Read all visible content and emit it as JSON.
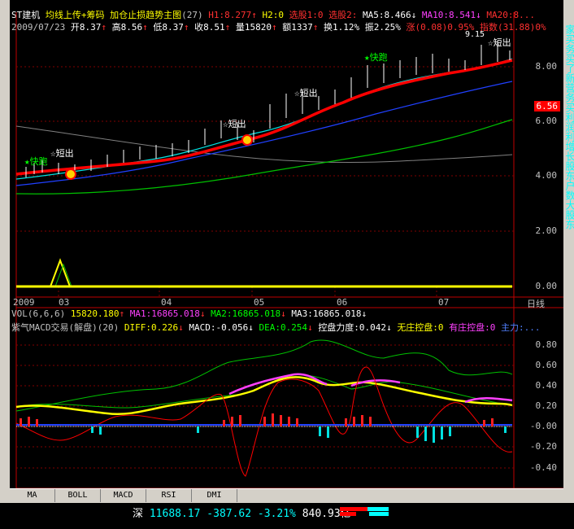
{
  "header": {
    "stock": "ST建机",
    "indicator_name": "均线上传+筹码 加仓止损趋势主图",
    "indicator_param": "(27)",
    "h1_label": "H1:",
    "h1_value": "8.277",
    "h1_arrow": "↑",
    "h2_label": "H2:0",
    "xuangu": "选股1:0",
    "xuangu2": "选股2:",
    "ma5": "MA5:8.466",
    "ma5_arrow": "↓",
    "ma10": "MA10:8.541",
    "ma10_arrow": "↓",
    "ma20": "MA20:8...",
    "date": "2009/07/23",
    "open": "开8.37",
    "open_arrow": "↑",
    "high": "高8.56",
    "high_arrow": "↑",
    "low": "低8.37",
    "low_arrow": "↑",
    "close": "收8.51",
    "close_arrow": "↑",
    "volume": "量15820",
    "volume_arrow": "↑",
    "amount": "额1337",
    "amount_arrow": "↑",
    "turnover": "换1.12%",
    "amplitude": "振2.25%",
    "change": "涨(0.08)0.95%",
    "index": "指数(31.88)0%"
  },
  "price_axis": {
    "labels": [
      "8.00",
      "6.00",
      "4.00",
      "2.00",
      "0.00"
    ],
    "current_price": "6.56",
    "top_value": "9.15"
  },
  "x_axis": {
    "labels": [
      "2009",
      "03",
      "04",
      "05",
      "06",
      "07"
    ],
    "right_label": "日线"
  },
  "chart_marks": {
    "buy_signal": "快跑",
    "short_out": "短出"
  },
  "volume_line": {
    "label": "VOL(6,6,6)",
    "value": "15820.180",
    "ma1": "MA1:16865.018",
    "ma2": "MA2:16865.018",
    "ma3": "MA3:16865.018"
  },
  "macd_line": {
    "label": "紫气MACD交易(解盘)(20)",
    "diff": "DIFF:0.226",
    "macd": "MACD:-0.056",
    "dea": "DEA:0.254",
    "force": "控盘力度:0.042",
    "no_pressure": "无庄控盘:0",
    "with_pressure": "有庄控盘:0",
    "main": "主力:..."
  },
  "macd_axis": {
    "labels": [
      "0.80",
      "0.60",
      "0.40",
      "0.20",
      "-0.00",
      "-0.20",
      "-0.40"
    ]
  },
  "tabs": [
    "MA",
    "BOLL",
    "MACD",
    "RSI",
    "DMI"
  ],
  "status": {
    "market": "深",
    "index": "11688.17",
    "change": "-387.62",
    "percent": "-3.21%",
    "amount": "840.93亿"
  },
  "right_panel": {
    "chars": "家买务买了新营务买利润利增长股东户数大股东"
  }
}
